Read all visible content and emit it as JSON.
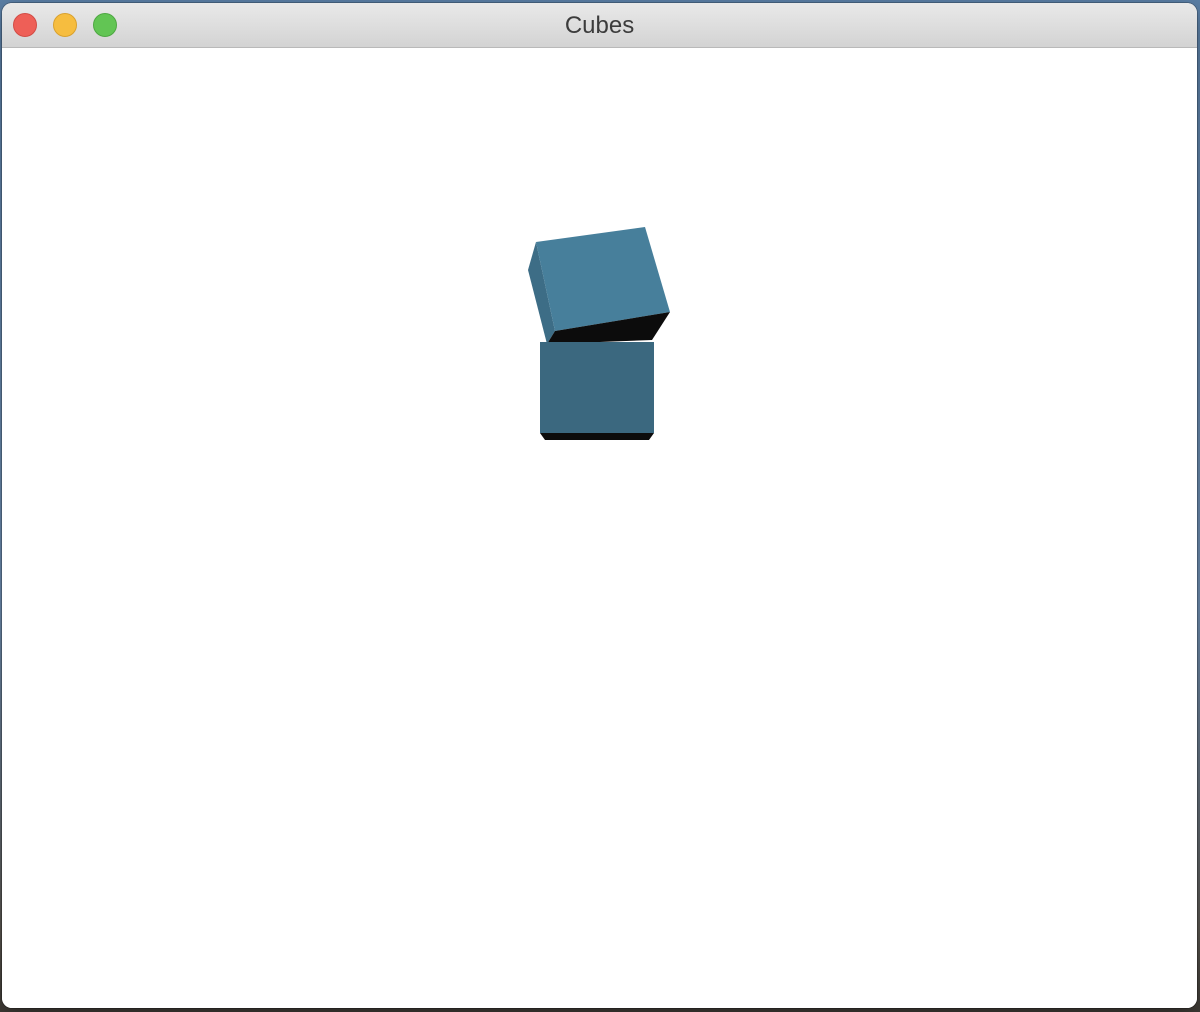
{
  "window": {
    "title": "Cubes"
  },
  "colors": {
    "cube_front": "#3b687f",
    "cube_top_face": "#477f9b",
    "cube_side_face": "#3d6d86",
    "cube_shadow_face": "#0c0c0c"
  },
  "icons": {
    "close": "close-traffic-light-icon",
    "minimize": "minimize-traffic-light-icon",
    "zoom": "zoom-traffic-light-icon"
  }
}
